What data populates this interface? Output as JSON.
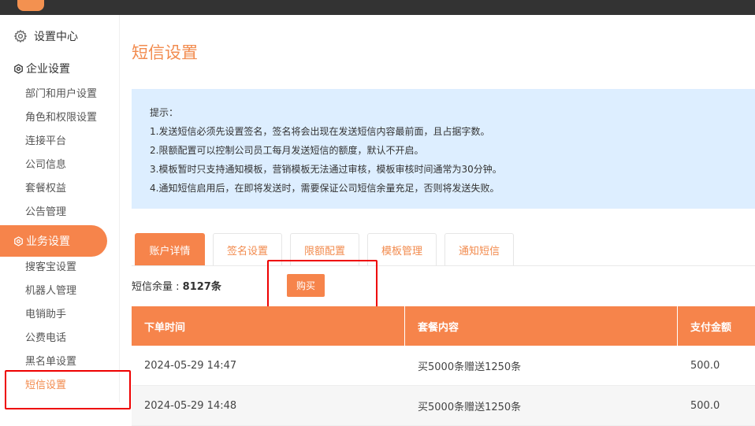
{
  "sidebar": {
    "settings_center": "设置中心",
    "enterprise_group": "企业设置",
    "enterprise_items": [
      "部门和用户设置",
      "角色和权限设置",
      "连接平台",
      "公司信息",
      "套餐权益",
      "公告管理"
    ],
    "business_group": "业务设置",
    "business_items": [
      "搜客宝设置",
      "机器人管理",
      "电销助手",
      "公费电话",
      "黑名单设置",
      "短信设置"
    ]
  },
  "main": {
    "title": "短信设置",
    "tips": [
      "提示：",
      "1.发送短信必须先设置签名，签名将会出现在发送短信内容最前面，且占据字数。",
      "2.限额配置可以控制公司员工每月发送短信的额度，默认不开启。",
      "3.模板暂时只支持通知模板，营销模板无法通过审核，模板审核时间通常为30分钟。",
      "4.通知短信启用后，在即将发送时，需要保证公司短信余量充足，否则将发送失败。"
    ],
    "tabs": [
      "账户详情",
      "签名设置",
      "限额配置",
      "模板管理",
      "通知短信"
    ],
    "balance_label": "短信余量 : ",
    "balance_value": "8127条",
    "buy_label": "购买",
    "table": {
      "headers": [
        "下单时间",
        "套餐内容",
        "支付金额"
      ],
      "rows": [
        [
          "2024-05-29 14:47",
          "买5000条赠送1250条",
          "500.0"
        ],
        [
          "2024-05-29 14:48",
          "买5000条赠送1250条",
          "500.0"
        ]
      ]
    }
  },
  "colors": {
    "accent": "#f6844b",
    "accent_text": "#f28b4e",
    "tips_bg": "#ddeeff",
    "highlight": "#ee0000"
  }
}
